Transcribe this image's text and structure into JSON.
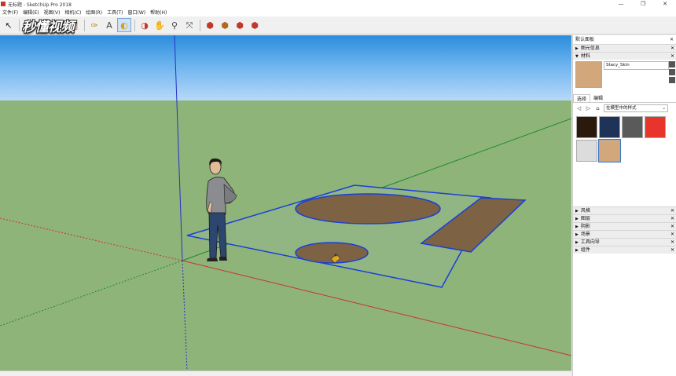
{
  "window": {
    "title": "无标题 - SketchUp Pro 2018",
    "controls": [
      "—",
      "❐",
      "✕"
    ]
  },
  "menu": [
    "文件(F)",
    "编辑(E)",
    "视图(V)",
    "相机(C)",
    "绘图(R)",
    "工具(T)",
    "窗口(W)",
    "帮助(H)"
  ],
  "watermark": "秒懂视频",
  "toolbar": {
    "tools": [
      {
        "icon": "select-arrow-icon",
        "glyph": "↖",
        "color": "#222"
      },
      {
        "icon": "pencil-line-icon",
        "glyph": "✎",
        "color": "#c0392b"
      },
      {
        "icon": "move-icon",
        "glyph": "✥",
        "color": "#c0392b"
      },
      {
        "icon": "rotate-icon",
        "glyph": "⟳",
        "color": "#c0392b"
      },
      {
        "icon": "scale-icon",
        "glyph": "◩",
        "color": "#b03a2e"
      },
      {
        "icon": "tape-measure-icon",
        "glyph": "✑",
        "color": "#b8860b"
      },
      {
        "icon": "text-icon",
        "glyph": "A",
        "color": "#444"
      },
      {
        "icon": "paint-bucket-icon",
        "glyph": "◐",
        "color": "#d4a017"
      },
      {
        "icon": "orbit-icon",
        "glyph": "◑",
        "color": "#c0392b"
      },
      {
        "icon": "pan-icon",
        "glyph": "✋",
        "color": "#c8a36b"
      },
      {
        "icon": "zoom-icon",
        "glyph": "⚲",
        "color": "#444"
      },
      {
        "icon": "zoom-extents-icon",
        "glyph": "⤧",
        "color": "#444"
      },
      {
        "icon": "warehouse-icon",
        "glyph": "⬢",
        "color": "#c0392b"
      },
      {
        "icon": "extension-warehouse-icon",
        "glyph": "⬢",
        "color": "#b5651d"
      },
      {
        "icon": "share-model-icon",
        "glyph": "⬢",
        "color": "#c0392b"
      },
      {
        "icon": "extension-manager-icon",
        "glyph": "⬢",
        "color": "#c0392b"
      }
    ]
  },
  "tray": {
    "title": "默认面板",
    "entity_info": "图元信息",
    "materials": "材料",
    "material_name": "Stacy_Skin",
    "material_color": "#d2a77c",
    "tabs": [
      "选择",
      "编辑"
    ],
    "collection": "在模型中的样式",
    "swatches": [
      "#2a1a0e",
      "#1f3358",
      "#5a5a5a",
      "#e8352b",
      "#dcdcdc",
      "#d2a77c"
    ],
    "sections": [
      "风格",
      "图层",
      "阴影",
      "场景",
      "工具向导",
      "组件"
    ]
  },
  "colors": {
    "sky_top": "#2a8cdc",
    "ground": "#8fb47a",
    "outline": "#1a3fd9",
    "brown_fill": "#7d6244"
  }
}
